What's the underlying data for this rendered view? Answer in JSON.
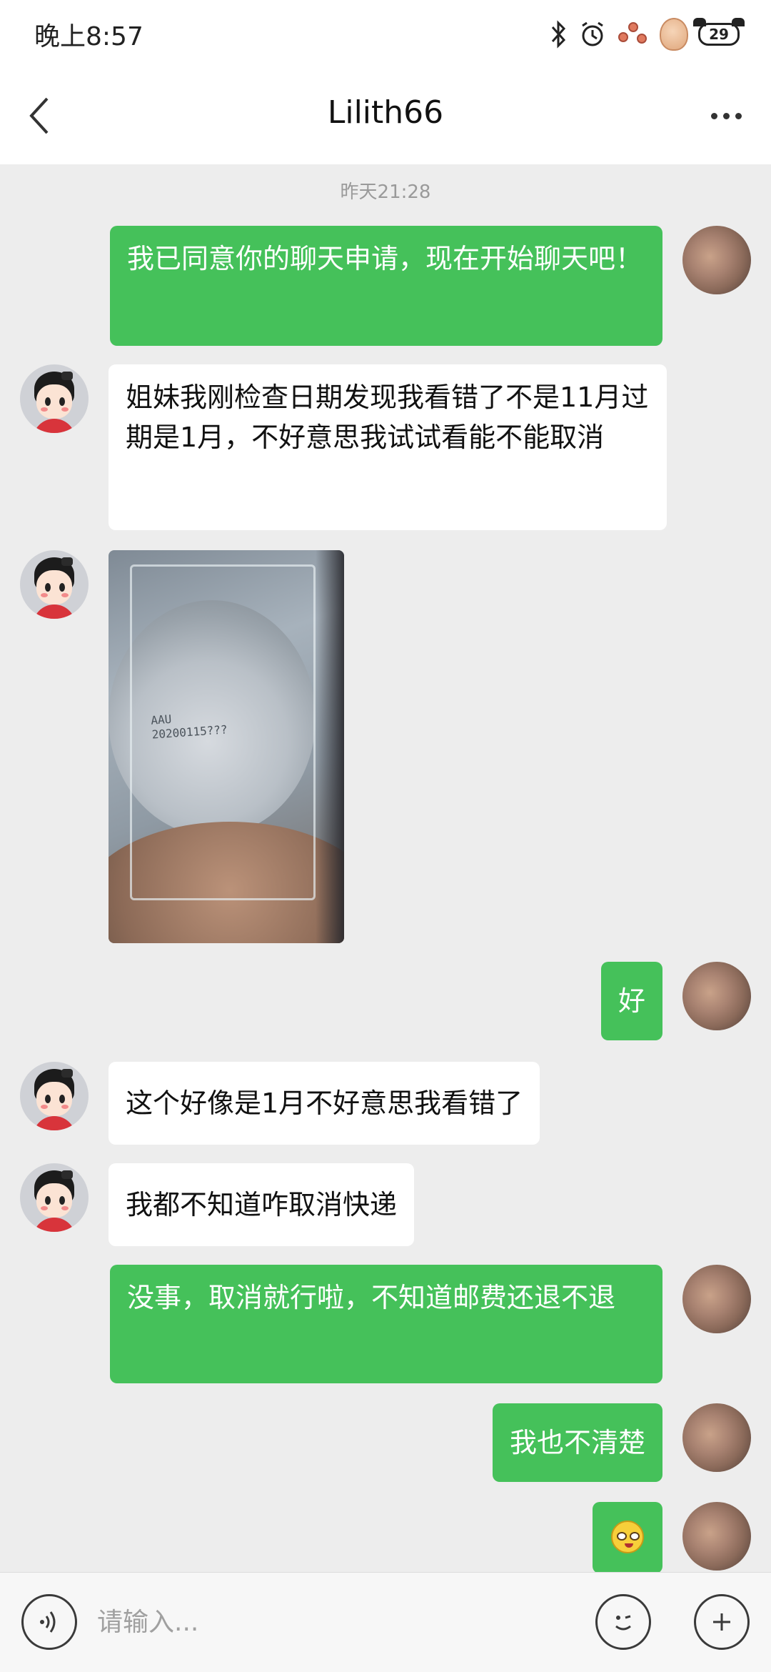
{
  "status_bar": {
    "time": "晚上8:57",
    "battery": "29",
    "icons": [
      "bluetooth-icon",
      "alarm-icon",
      "flowers-icon",
      "cookie-icon",
      "battery-icon"
    ]
  },
  "header": {
    "title": "Lilith66",
    "back_icon": "chevron-left-icon",
    "more_icon": "more-dots-icon"
  },
  "chat": {
    "timestamp": "昨天21:28",
    "messages": [
      {
        "side": "right",
        "type": "text",
        "text": "我已同意你的聊天申请，现在开始聊天吧！"
      },
      {
        "side": "left",
        "type": "text",
        "text": "姐妹我刚检查日期发现我看错了不是11月过期是1月，不好意思我试试看能不能取消"
      },
      {
        "side": "left",
        "type": "image",
        "image_text": "AAU\n20200115????"
      },
      {
        "side": "right",
        "type": "text",
        "text": "好"
      },
      {
        "side": "left",
        "type": "text",
        "text": "这个好像是1月不好意思我看错了"
      },
      {
        "side": "left",
        "type": "text",
        "text": "我都不知道咋取消快递"
      },
      {
        "side": "right",
        "type": "text",
        "text": "没事，取消就行啦，不知道邮费还退不退"
      },
      {
        "side": "right",
        "type": "text",
        "text": "我也不清楚"
      },
      {
        "side": "right",
        "type": "emoji",
        "emoji": "crying-emoji-icon"
      }
    ]
  },
  "input_bar": {
    "placeholder": "请输入...",
    "voice_icon": "voice-icon",
    "emoji_icon": "emoji-icon",
    "plus_icon": "plus-icon"
  },
  "colors": {
    "my_bubble": "#45c15a",
    "their_bubble": "#ffffff",
    "background": "#ededed"
  }
}
